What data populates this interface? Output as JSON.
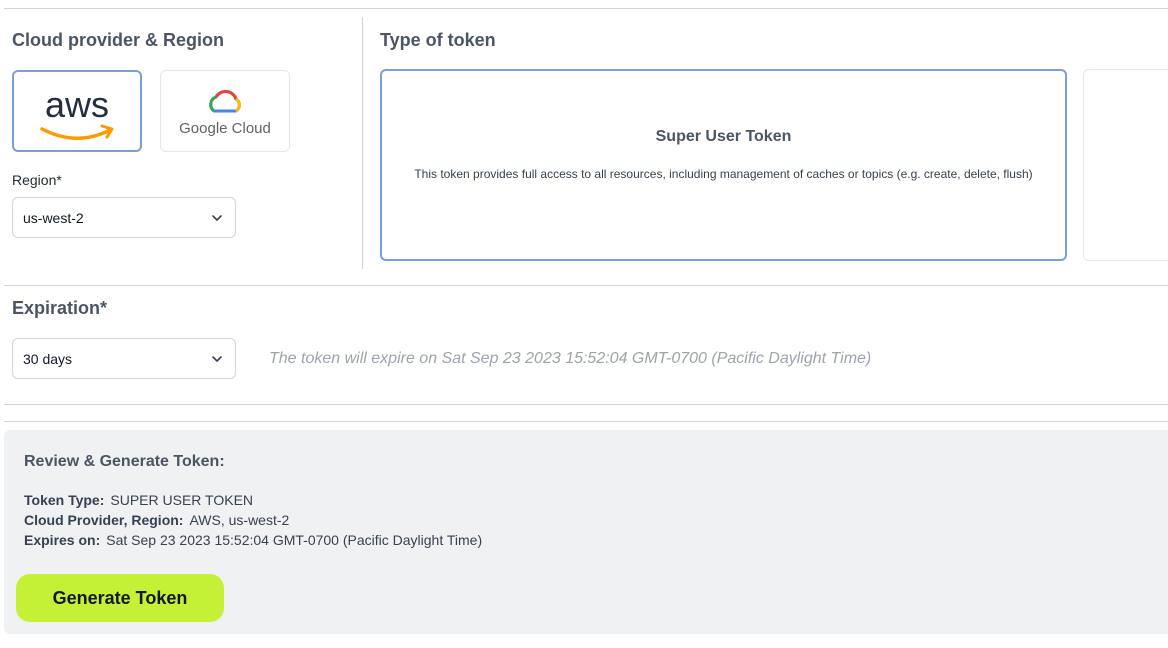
{
  "provider_section": {
    "title": "Cloud provider & Region",
    "providers": [
      {
        "name": "AWS",
        "logo_text": "aws",
        "selected": true
      },
      {
        "name": "Google Cloud",
        "logo_text": "Google Cloud",
        "selected": false
      }
    ],
    "region_label": "Region*",
    "region_value": "us-west-2"
  },
  "token_section": {
    "title": "Type of token",
    "selected_token": {
      "title": "Super User Token",
      "description": "This token provides full access to all resources, including management of caches or topics (e.g. create, delete, flush)"
    }
  },
  "expiration": {
    "title": "Expiration*",
    "value": "30 days",
    "note": "The token will expire on Sat Sep 23 2023 15:52:04 GMT-0700 (Pacific Daylight Time)"
  },
  "review": {
    "title": "Review & Generate Token:",
    "token_type_label": "Token Type:",
    "token_type_value": "SUPER USER TOKEN",
    "provider_label": "Cloud Provider, Region:",
    "provider_value": "AWS, us-west-2",
    "expires_label": "Expires on:",
    "expires_value": "Sat Sep 23 2023 15:52:04 GMT-0700 (Pacific Daylight Time)"
  },
  "generate_button": {
    "label": "Generate Token"
  },
  "colors": {
    "accent_button": "#c4f135",
    "selected_border": "#7c9ce0",
    "aws_orange": "#f90"
  }
}
